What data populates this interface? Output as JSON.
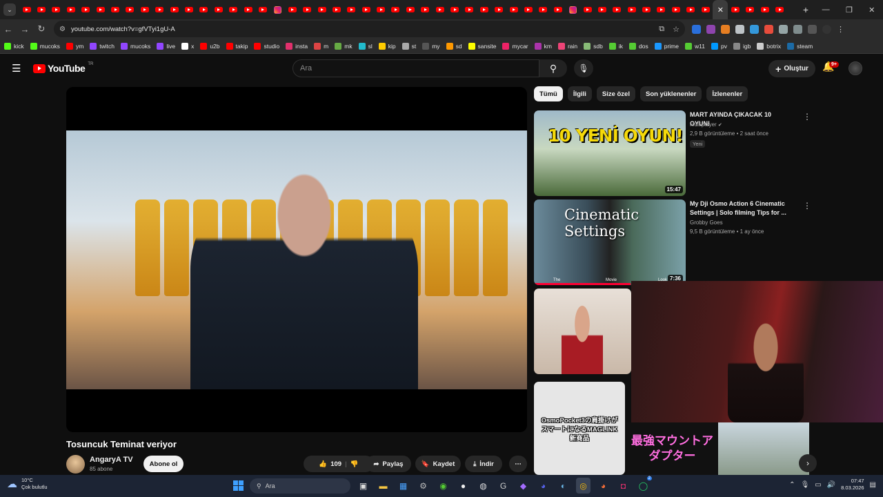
{
  "browser": {
    "url": "youtube.com/watch?v=gfVTyi1gU-A",
    "tab_count_yt_before": 17,
    "bookmarks": [
      {
        "label": "kick",
        "color": "#53fc18"
      },
      {
        "label": "mucoks",
        "color": "#53fc18"
      },
      {
        "label": "ym",
        "color": "#ff0000"
      },
      {
        "label": "twitch",
        "color": "#9146ff"
      },
      {
        "label": "mucoks",
        "color": "#9146ff"
      },
      {
        "label": "live",
        "color": "#9146ff"
      },
      {
        "label": "x",
        "color": "#ffffff"
      },
      {
        "label": "u2b",
        "color": "#ff0000"
      },
      {
        "label": "takip",
        "color": "#ff0000"
      },
      {
        "label": "studio",
        "color": "#ff0000"
      },
      {
        "label": "insta",
        "color": "#e1306c"
      },
      {
        "label": "m",
        "color": "#d44"
      },
      {
        "label": "mk",
        "color": "#6a4"
      },
      {
        "label": "sl",
        "color": "#2bc"
      },
      {
        "label": "kip",
        "color": "#fc0"
      },
      {
        "label": "st",
        "color": "#aaa"
      },
      {
        "label": "my",
        "color": "#555"
      },
      {
        "label": "sd",
        "color": "#f90"
      },
      {
        "label": "sansite",
        "color": "#ff0"
      },
      {
        "label": "mycar",
        "color": "#e26"
      },
      {
        "label": "km",
        "color": "#a3a"
      },
      {
        "label": "rain",
        "color": "#e47"
      },
      {
        "label": "sdb",
        "color": "#8b7"
      },
      {
        "label": "ik",
        "color": "#5c3"
      },
      {
        "label": "dos",
        "color": "#5c3"
      },
      {
        "label": "prime",
        "color": "#1a98ff"
      },
      {
        "label": "w11",
        "color": "#5c3"
      },
      {
        "label": "pv",
        "color": "#09f"
      },
      {
        "label": "igb",
        "color": "#888"
      },
      {
        "label": "botrix",
        "color": "#ccc"
      },
      {
        "label": "steam",
        "color": "#1b6aa5"
      }
    ]
  },
  "youtube": {
    "logo": "YouTube",
    "region": "TR",
    "search_placeholder": "Ara",
    "create_label": "Oluştur",
    "notifications_badge": "9+",
    "video": {
      "title": "Tosuncuk Teminat veriyor",
      "channel": "AngaryA  TV",
      "subscribers": "85 abone",
      "subscribe_label": "Abone ol",
      "likes": "109",
      "share_label": "Paylaş",
      "save_label": "Kaydet",
      "download_label": "İndir"
    },
    "chips": [
      {
        "label": "Tümü",
        "selected": true
      },
      {
        "label": "İlgili",
        "selected": false
      },
      {
        "label": "Size özel",
        "selected": false
      },
      {
        "label": "Son yüklenenler",
        "selected": false
      },
      {
        "label": "İzlenenler",
        "selected": false
      }
    ],
    "recommendations": [
      {
        "title": "MART AYINDA ÇIKACAK 10 OYUN!",
        "channel": "Multiplayer",
        "verified": true,
        "meta": "2,9 B görüntüleme • 2 saat önce",
        "badge": "Yeni",
        "duration": "15:47",
        "thumb_text": "10 YENİ OYUN!"
      },
      {
        "title": "My Dji Osmo Action 6 Cinematic Settings | Solo filming Tips for ...",
        "channel": "Grobby Goes",
        "meta": "9,5 B görüntüleme • 1 ay önce",
        "duration": "7:36",
        "thumb_text": "Cinematic Settings",
        "thumb_labels": [
          "The",
          "Movie",
          "Look"
        ]
      }
    ],
    "jp_thumb_text": "OsmoPocket3の肩掛けがスマートになるMAGLINK新商品",
    "jp_banner": "最強マウントアダプター"
  },
  "taskbar": {
    "temp": "10°C",
    "weather": "Çok bulutlu",
    "search_placeholder": "Ara",
    "time": "07:47",
    "date": "8.03.2026",
    "whatsapp_badge": "2"
  }
}
